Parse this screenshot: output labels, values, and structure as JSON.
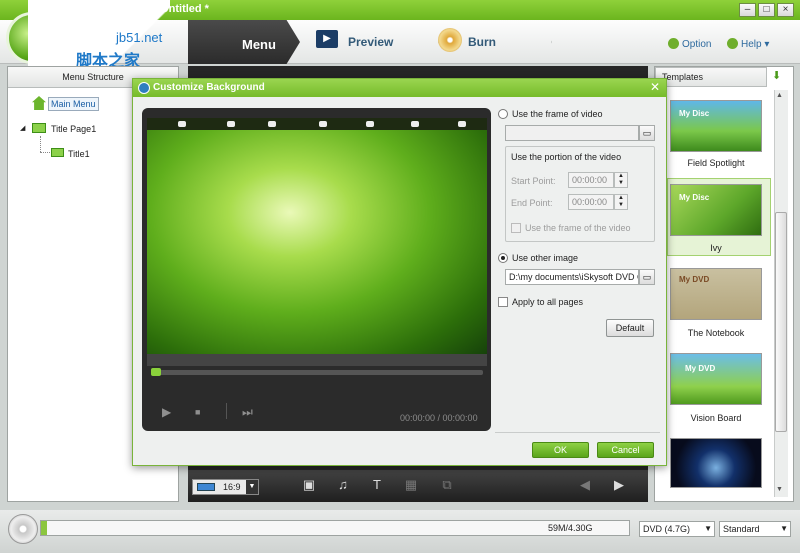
{
  "window": {
    "title": "iSkysoft DVD Cr... - Untitled *",
    "minimize_icon": "minimize-icon",
    "maximize_icon": "maximize-icon",
    "close_icon": "close-icon"
  },
  "watermark": {
    "line1": "jb51.net",
    "line2": "脚本之家"
  },
  "nav": {
    "menu": "Menu",
    "preview": "Preview",
    "burn": "Burn",
    "option": "Option",
    "help": "Help ▾"
  },
  "left_panel": {
    "header": "Menu Structure",
    "items": [
      {
        "label": "Main Menu"
      },
      {
        "label": "Title Page1"
      },
      {
        "label": "Title1"
      }
    ]
  },
  "right_panel": {
    "header": "Templates",
    "templates": [
      {
        "name": "Field Spotlight",
        "caption": "My Disc"
      },
      {
        "name": "Ivy",
        "caption": "My Disc"
      },
      {
        "name": "The Notebook",
        "caption": "My DVD"
      },
      {
        "name": "Vision Board",
        "caption": "My DVD"
      }
    ]
  },
  "bottom_toolbar": {
    "ratio": "16:9"
  },
  "status": {
    "used": "59M/4.30G",
    "disc_type": "DVD (4.7G)",
    "quality": "Standard",
    "used_fraction": 0.013
  },
  "dialog": {
    "title": "Customize Background",
    "use_frame_label": "Use the frame of video",
    "frame_path": "",
    "portion_label": "Use the portion of the video",
    "start_label": "Start Point:",
    "start_value": "00:00:00",
    "end_label": "End Point:",
    "end_value": "00:00:00",
    "use_frame_check_label": "Use the frame of the video",
    "use_other_label": "Use other image",
    "other_path": "D:\\my documents\\iSkysoft DVD C",
    "apply_all_label": "Apply to all pages",
    "default_label": "Default",
    "ok_label": "OK",
    "cancel_label": "Cancel",
    "time_display": "00:00:00 / 00:00:00"
  },
  "colors": {
    "accent": "#76bb2a",
    "link": "#2e6a9e"
  }
}
